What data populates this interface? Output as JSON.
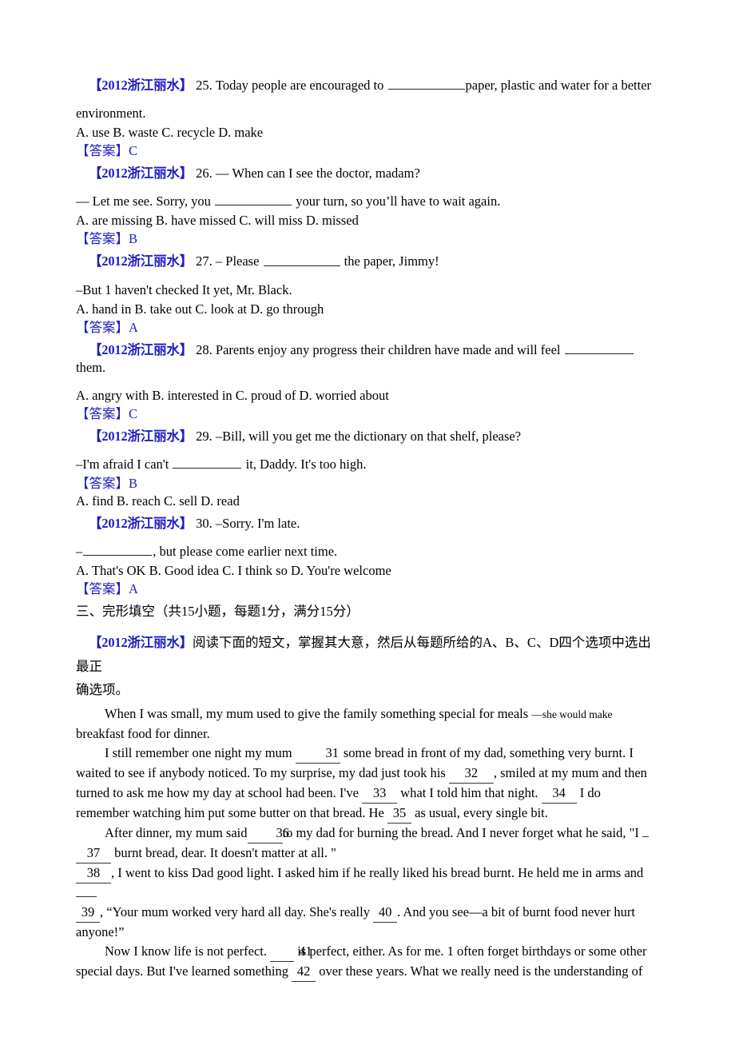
{
  "document": {
    "source_tag": "【2012浙江丽水】",
    "answer_tag": "【答案】"
  },
  "questions": [
    {
      "number": "25.",
      "stem_before": "25. Today people are encouraged to ",
      "stem_after": "paper, plastic and water for a better",
      "continuation": "environment.",
      "options": "A. use   B. waste       C. recycle          D. make",
      "answer": "C"
    },
    {
      "number": "26.",
      "stem_before": "26. — When can I see the doctor, madam?",
      "stem_after": "",
      "continuation_before": "— Let me see. Sorry, you ",
      "continuation_after": " your turn, so you’ll have to wait again.",
      "options": "A. are missing       B. have missed        C. will miss       D. missed",
      "answer": "B"
    },
    {
      "number": "27.",
      "stem_before": "27. – Please ",
      "stem_after": " the paper, Jimmy!",
      "continuation": " –But 1 haven't checked It yet, Mr. Black.",
      "options": "A. hand in    B. take out       C. look at        D. go through",
      "answer": "A"
    },
    {
      "number": "28.",
      "stem_before": "28. Parents enjoy any progress their children have made and will feel ",
      "stem_after": " them.",
      "options": "A. angry with      B. interested in           C. proud of             D. worried about",
      "answer": "C"
    },
    {
      "number": "29.",
      "stem_before": "29. –Bill, will you get me the dictionary on that shelf, please?",
      "continuation_before": "–I'm afraid I can't ",
      "continuation_after": " it, Daddy. It's too high.",
      "answer": "B",
      "options": "A. find       B. reach       C. sell       D. read",
      "answer_before_options": true
    },
    {
      "number": "30.",
      "stem_before": "30. –Sorry. I'm late.",
      "continuation_before": "–",
      "continuation_after": ", but please come earlier next time.",
      "options": "A. That's OK           B. Good idea        C. I think so       D. You're welcome",
      "answer": "A"
    }
  ],
  "section": {
    "heading": "三、完形填空（共15小题，每题1分，满分15分）",
    "instruction_line1": "阅读下面的短文，掌握其大意，然后从每题所给的A、B、C、D四个选项中选出最正",
    "instruction_line2": "确选项。"
  },
  "passage": {
    "p1_a": "When I was small, my mum used to give the family something special for meals ",
    "p1_small": "—she would make",
    "p1_b": "breakfast food for dinner.",
    "p2_a": "I still remember one night my mum ",
    "p2_n31": "31",
    "p2_b": " some bread in front of my dad, something very burnt. I",
    "p2_c": "waited to see if anybody noticed. To my surprise, my dad just took his ",
    "p2_n32": "32",
    "p2_d": ", smiled at my mum and then",
    "p2_e": "turned to ask me how my day at school had been. I've ",
    "p2_n33": "33",
    "p2_f": " what I told him that night. ",
    "p2_n34": "34",
    "p2_g": " I do",
    "p2_h": "remember watching him put some butter on that bread. He ",
    "p2_n35": "35",
    "p2_i": " as usual, every single bit.",
    "p3_a": "After dinner, my mum said",
    "p3_n36": "36",
    "p3_b": "to my dad for burning the bread. And I never forget what he said, \"I ",
    "p3_n37": "37",
    "p3_c": " burnt bread, dear. It doesn't matter at all. \"",
    "p4_n38": "38",
    "p4_a": ", I went to kiss Dad good light. I asked him if he really liked his bread burnt. He held me in arms and",
    "p4_n39": "39",
    "p4_b": ", “Your mum worked very hard all day. She's really ",
    "p4_n40": "40",
    "p4_c": ". And you see—a bit of burnt food never hurt",
    "p4_d": "anyone!”",
    "p5_a": "Now I know life is not perfect. ",
    "p5_n41": "41",
    "p5_b": " is perfect, either. As for me. 1 often forget birthdays or some other",
    "p5_c": "special days. But I've learned something ",
    "p5_n42": "42",
    "p5_d": " over these years. What we really need is the understanding of"
  },
  "colors": {
    "blue": "#1f1fbf",
    "text": "#000000",
    "background": "#ffffff"
  }
}
